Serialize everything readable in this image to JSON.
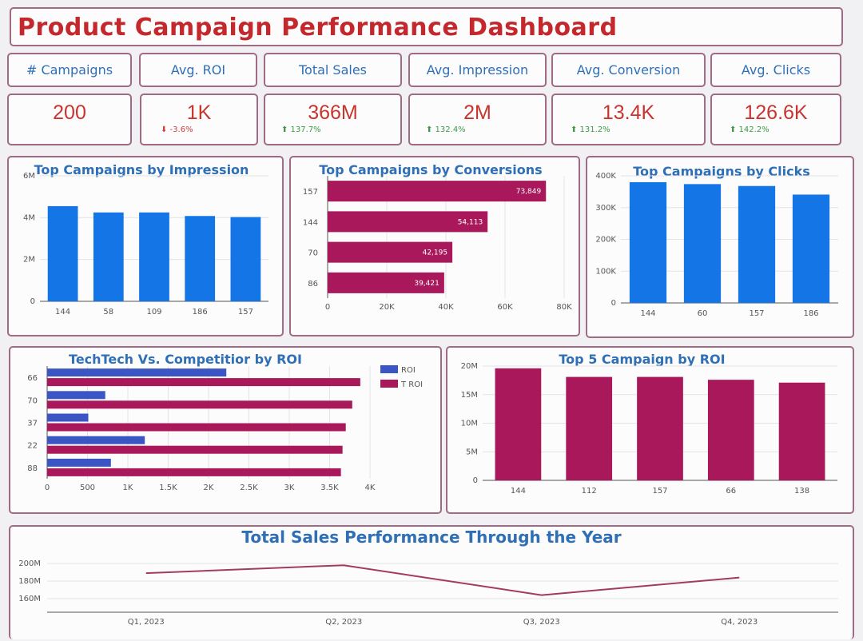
{
  "dashboard": {
    "title": "Product Campaign Performance Dashboard"
  },
  "kpis": [
    {
      "label": "# Campaigns",
      "value": "200",
      "delta": ""
    },
    {
      "label": "Avg. ROI",
      "value": "1K",
      "delta": "⬇ -3.6%",
      "trend": "down"
    },
    {
      "label": "Total Sales",
      "value": "366M",
      "delta": "⬆ 137.7%",
      "trend": "up"
    },
    {
      "label": "Avg. Impression",
      "value": "2M",
      "delta": "⬆ 132.4%",
      "trend": "up"
    },
    {
      "label": "Avg. Conversion",
      "value": "13.4K",
      "delta": "⬆ 131.2%",
      "trend": "up"
    },
    {
      "label": "Avg. Clicks",
      "value": "126.6K",
      "delta": "⬆ 142.2%",
      "trend": "up"
    }
  ],
  "colors": {
    "blue": "#1476e6",
    "crimson": "#a8185a",
    "roi_blue": "#3c55c4",
    "line": "#a33a62"
  },
  "chart_data": [
    {
      "type": "bar",
      "title": "Top Campaigns by Impression",
      "categories": [
        "144",
        "58",
        "109",
        "186",
        "157"
      ],
      "values": [
        4550000,
        4250000,
        4250000,
        4080000,
        4030000
      ],
      "ylim": [
        0,
        6000000
      ],
      "yticks": [
        "0",
        "2M",
        "4M",
        "6M"
      ],
      "grid": true
    },
    {
      "type": "bar",
      "orientation": "horizontal",
      "title": "Top Campaigns by Conversions",
      "categories": [
        "157",
        "144",
        "70",
        "86"
      ],
      "values": [
        73849,
        54113,
        42195,
        39421
      ],
      "value_labels": [
        "73,849",
        "54,113",
        "42,195",
        "39,421"
      ],
      "xlim": [
        0,
        80000
      ],
      "xticks": [
        "0",
        "20K",
        "40K",
        "60K",
        "80K"
      ],
      "grid": true
    },
    {
      "type": "bar",
      "title": "Top Campaigns by Clicks",
      "categories": [
        "144",
        "60",
        "157",
        "186"
      ],
      "values": [
        380000,
        374000,
        368000,
        341000
      ],
      "ylim": [
        0,
        400000
      ],
      "yticks": [
        "0",
        "100K",
        "200K",
        "300K",
        "400K"
      ],
      "grid": true
    },
    {
      "type": "bar",
      "orientation": "horizontal",
      "title": "TechTech Vs. Competitior by ROI",
      "categories": [
        "66",
        "70",
        "37",
        "22",
        "88"
      ],
      "series": [
        {
          "name": "ROI",
          "values": [
            2220,
            720,
            510,
            1210,
            790
          ]
        },
        {
          "name": "T ROI",
          "values": [
            3880,
            3780,
            3700,
            3660,
            3640
          ]
        }
      ],
      "xlim": [
        0,
        4000
      ],
      "xticks": [
        "0",
        "500",
        "1K",
        "1.5K",
        "2K",
        "2.5K",
        "3K",
        "3.5K",
        "4K"
      ],
      "legend": "top-right",
      "grid": true
    },
    {
      "type": "bar",
      "title": "Top 5 Campaign by ROI",
      "categories": [
        "144",
        "112",
        "157",
        "66",
        "138"
      ],
      "values": [
        19600000,
        18100000,
        18100000,
        17600000,
        17100000
      ],
      "ylim": [
        0,
        20000000
      ],
      "yticks": [
        "0",
        "5M",
        "10M",
        "15M",
        "20M"
      ],
      "grid": true
    },
    {
      "type": "line",
      "title": "Total Sales Performance Through the Year",
      "categories": [
        "Q1, 2023",
        "Q2, 2023",
        "Q3, 2023",
        "Q4, 2023"
      ],
      "values": [
        189000000,
        198000000,
        164000000,
        184000000
      ],
      "ylim": [
        150000000,
        210000000
      ],
      "yticks": [
        "160M",
        "180M",
        "200M"
      ],
      "grid": true
    }
  ]
}
